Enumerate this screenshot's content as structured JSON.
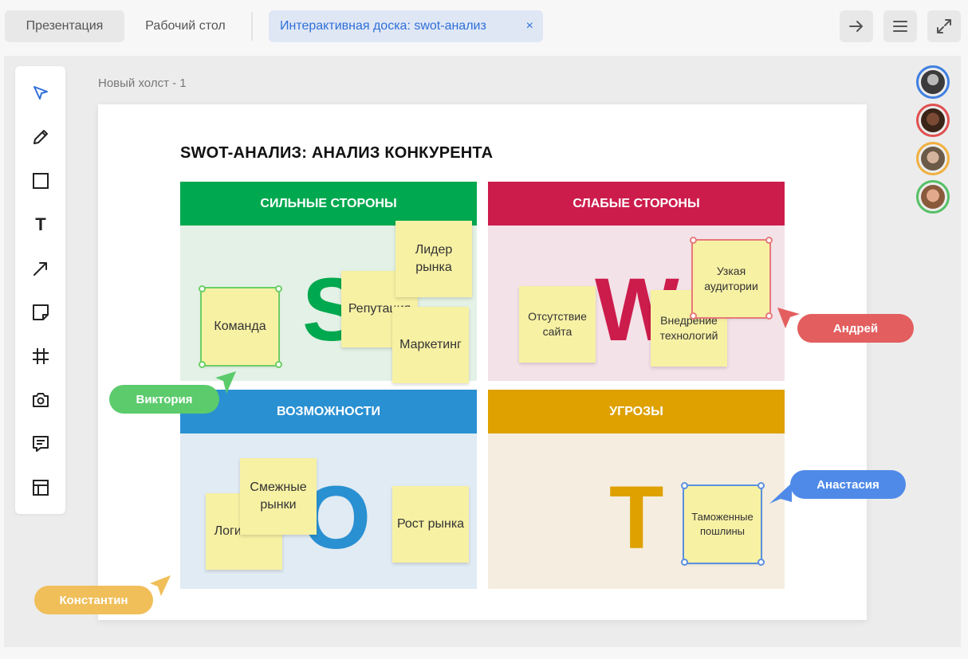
{
  "tabs": {
    "presentation": "Презентация",
    "desktop": "Рабочий стол",
    "whiteboard": "Интерактивная доска: swot-анализ",
    "close_symbol": "×"
  },
  "top_buttons": [
    "arrow-right-icon",
    "menu-icon",
    "expand-icon"
  ],
  "toolbar": [
    "cursor-icon",
    "pencil-icon",
    "rectangle-icon",
    "text-icon",
    "arrow-icon",
    "sticky-note-icon",
    "frame-icon",
    "camera-icon",
    "comment-icon",
    "template-icon"
  ],
  "toolbar_text_glyph": "T",
  "canvas": {
    "title": "Новый холст - 1"
  },
  "board": {
    "title": "SWOT-АНАЛИЗ: АНАЛИЗ КОНКУРЕНТА",
    "strengths": {
      "header": "СИЛЬНЫЕ СТОРОНЫ",
      "letter": "S",
      "color": "#00a84f",
      "bg": "#e3f1e6",
      "notes": [
        "Команда",
        "Репутация",
        "Лидер рынка",
        "Маркетинг"
      ]
    },
    "weaknesses": {
      "header": "СЛАБЫЕ СТОРОНЫ",
      "letter": "W",
      "color": "#cc1c4c",
      "bg": "#f3e2e8",
      "notes": [
        "Отсутствие сайта",
        "Внедрение технологий",
        "Узкая аудитории"
      ]
    },
    "opportunities": {
      "header": "ВОЗМОЖНОСТИ",
      "letter": "O",
      "color": "#2990d2",
      "bg": "#e1ebf3",
      "notes": [
        "Логистика",
        "Смежные рынки",
        "Рост рынка"
      ]
    },
    "threats": {
      "header": "УГРОЗЫ",
      "letter": "T",
      "color": "#dea100",
      "bg": "#f5eee0",
      "notes": [
        "Таможенные пошлины"
      ]
    }
  },
  "collaborators": {
    "viktoria": {
      "name": "Виктория",
      "color": "#5ccb6c"
    },
    "andrey": {
      "name": "Андрей",
      "color": "#e35f5f"
    },
    "anastasia": {
      "name": "Анастасия",
      "color": "#4f8ae8"
    },
    "konstantin": {
      "name": "Константин",
      "color": "#f0bf5a"
    }
  },
  "avatars": [
    {
      "color": "#3f7fe0"
    },
    {
      "color": "#e05050"
    },
    {
      "color": "#f0b040"
    },
    {
      "color": "#55c065"
    }
  ]
}
